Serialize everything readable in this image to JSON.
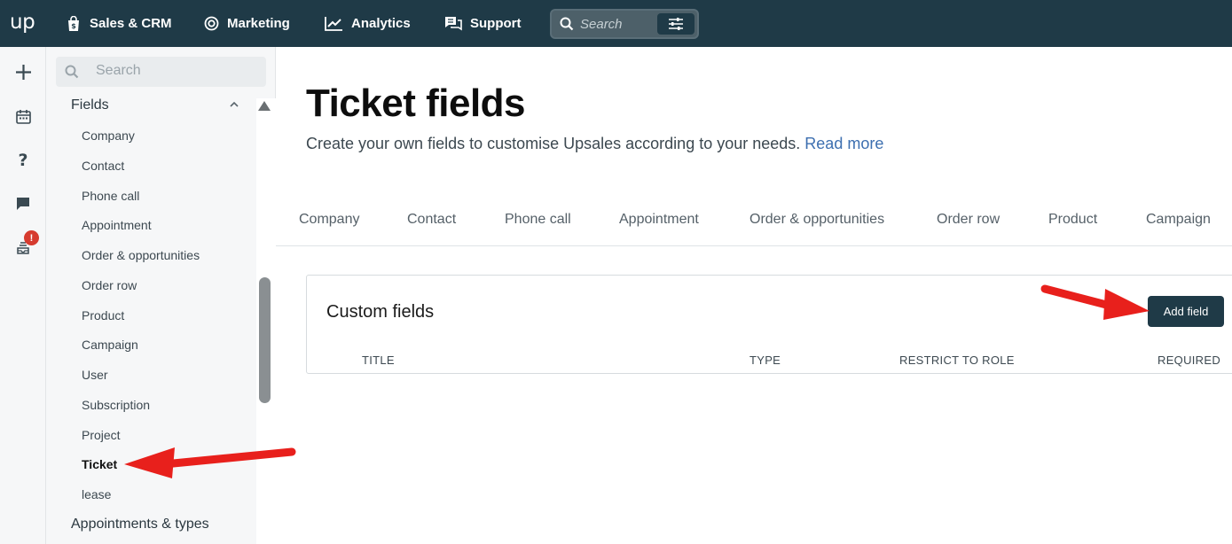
{
  "topbar": {
    "logo": "up",
    "nav": [
      {
        "label": "Sales & CRM",
        "icon": "bag-icon"
      },
      {
        "label": "Marketing",
        "icon": "target-icon"
      },
      {
        "label": "Analytics",
        "icon": "chart-line-icon"
      },
      {
        "label": "Support",
        "icon": "chat-bubbles-icon"
      }
    ],
    "search_placeholder": "Search"
  },
  "sidebar": {
    "search_placeholder": "Search",
    "section_fields": "Fields",
    "items": [
      "Company",
      "Contact",
      "Phone call",
      "Appointment",
      "Order & opportunities",
      "Order row",
      "Product",
      "Campaign",
      "User",
      "Subscription",
      "Project",
      "Ticket",
      "lease"
    ],
    "active_item": "Ticket",
    "section_next": "Appointments & types",
    "rail_badge": "!"
  },
  "main": {
    "title": "Ticket fields",
    "subtitle": "Create your own fields to customise Upsales according to your needs.",
    "read_more": "Read more",
    "tabs": [
      "Company",
      "Contact",
      "Phone call",
      "Appointment",
      "Order & opportunities",
      "Order row",
      "Product",
      "Campaign"
    ],
    "card": {
      "title": "Custom fields",
      "add_button": "Add field",
      "columns": [
        "TITLE",
        "TYPE",
        "RESTRICT TO ROLE",
        "REQUIRED"
      ]
    }
  },
  "colors": {
    "topbar": "#1f3a47",
    "sidebar_bg": "#f6f7f8",
    "link": "#3d6fb0",
    "badge": "#d63b2f",
    "annotation_arrow": "#e8201c"
  }
}
